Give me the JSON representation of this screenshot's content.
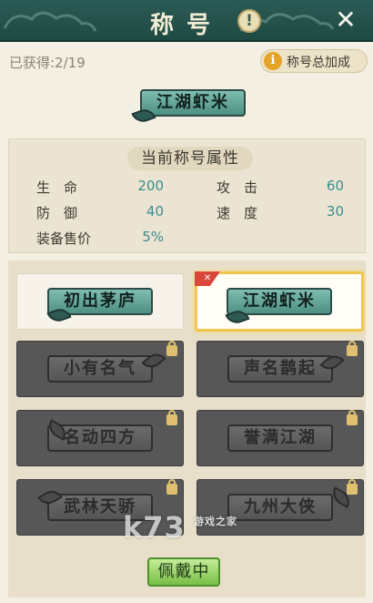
{
  "header": {
    "title": "称号",
    "info_icon": "exclamation-icon",
    "close_icon": "close-icon"
  },
  "summary": {
    "obtained_label": "已获得:2/19",
    "bonus_button_label": "称号总加成"
  },
  "current_title": "江湖虾米",
  "attributes": {
    "heading": "当前称号属性",
    "rows": [
      {
        "label": "生　命",
        "value": "200"
      },
      {
        "label": "攻　击",
        "value": "60"
      },
      {
        "label": "防　御",
        "value": "40"
      },
      {
        "label": "速　度",
        "value": "30"
      },
      {
        "label": "装备售价",
        "value": "5%"
      }
    ]
  },
  "titles": [
    {
      "name": "初出茅庐",
      "state": "unlocked"
    },
    {
      "name": "江湖虾米",
      "state": "selected"
    },
    {
      "name": "小有名气",
      "state": "locked"
    },
    {
      "name": "声名鹊起",
      "state": "locked"
    },
    {
      "name": "名动四方",
      "state": "locked"
    },
    {
      "name": "誉满江湖",
      "state": "locked"
    },
    {
      "name": "武林天骄",
      "state": "locked"
    },
    {
      "name": "九州大侠",
      "state": "locked"
    }
  ],
  "wear_button_label": "佩戴中",
  "watermark": {
    "main": "k73",
    "sub": "游戏之家"
  },
  "colors": {
    "header_bg": "#2b5a54",
    "panel_bg": "#f4efe3",
    "jade": "#6aa89b",
    "value_teal": "#3d8c8c",
    "selected_border": "#f0c650",
    "wear_green": "#8ccc56"
  }
}
